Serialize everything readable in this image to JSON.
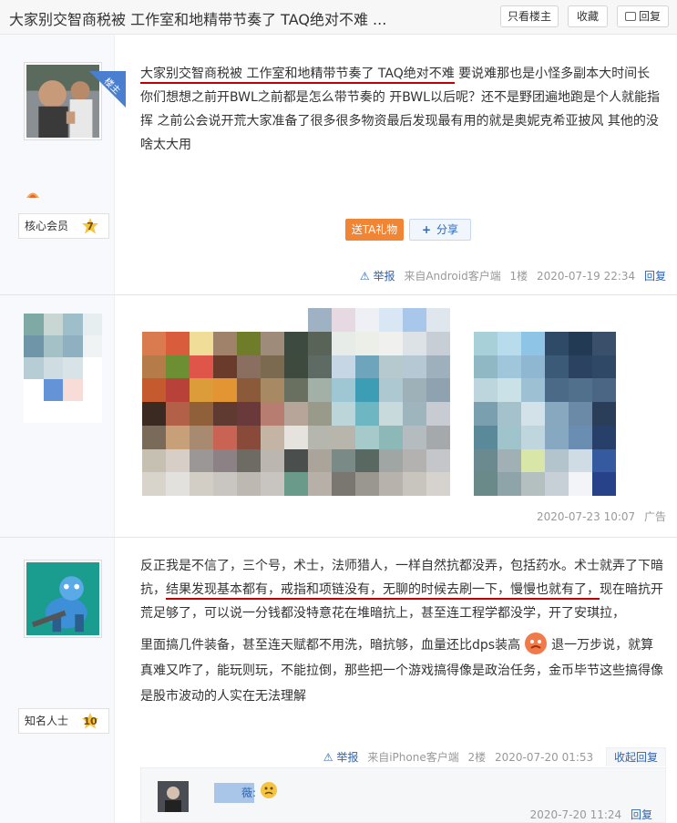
{
  "header": {
    "title": "大家别交智商税被 工作室和地精带节奏了 TAQ绝对不难 ...",
    "only_op_label": "只看楼主",
    "favorite_label": "收藏",
    "reply_label": "回复"
  },
  "posts": [
    {
      "badge": "楼主",
      "rank_label": "核心会员",
      "level": "7",
      "text_underlined": "大家别交智商税被 工作室和地精带节奏了 TAQ绝对不难",
      "text_rest": " 要说难那也是小怪多副本大时间长 你们想想之前开BWL之前都是怎么带节奏的 开BWL以后呢？还不是野团遍地跑是个人就能指挥 之前公会说开荒大家准备了很多很多物资最后发现最有用的就是奥妮克希亚披风 其他的没啥太大用",
      "gift_label": "送TA礼物",
      "share_label": "分享",
      "report_label": "举报",
      "source": "来自Android客户端",
      "floor": "1楼",
      "time": "2020-07-19 22:34",
      "reply_label": "回复"
    },
    {
      "time": "2020-07-23 10:07",
      "ad_label": "广告"
    },
    {
      "rank_label": "知名人士",
      "level": "10",
      "text_a": "反正我是不信了，三个号，术士，法师猎人，一样自然抗都没弄，包括药水。术士就弄了下暗抗，",
      "text_underlined": "结果发现基本都有，戒指和项链没有，无聊的时候去刷一下，慢慢也就有了，",
      "text_b": "现在暗抗开荒足够了，可以说一分钱都没特意花在堆暗抗上，甚至连工程学都没学，开了安琪拉，",
      "text_c": "里面搞几件装备，甚至连天赋都不用洗，暗抗够，血量还比dps装高",
      "text_d": "退一万步说，就算真难又咋了，能玩则玩，不能拉倒，那些把一个游戏搞得像是政治任务，金币毕节这些搞得像是股市波动的人实在无法理解",
      "report_label": "举报",
      "source": "来自iPhone客户端",
      "floor": "2楼",
      "time": "2020-07-20 01:53",
      "collapse_label": "收起回复"
    }
  ],
  "subreply": {
    "name_fragment": "薇:",
    "time": "2020-7-20 11:24",
    "reply_label": "回复"
  },
  "colors": {
    "link": "#2d64b3",
    "underline": "#c00000",
    "gift": "#f08536",
    "badge": "#4a7fd0"
  }
}
